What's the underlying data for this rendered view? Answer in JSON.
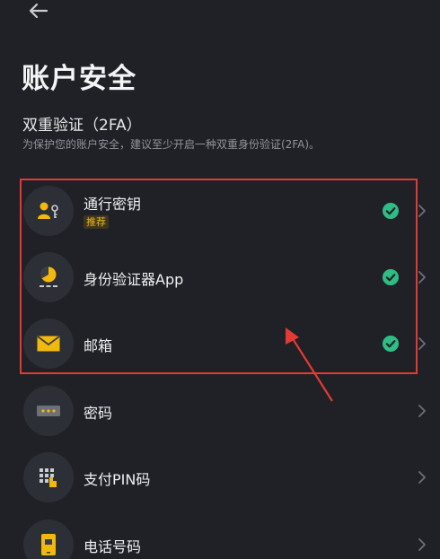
{
  "header": {
    "back_icon": "arrow-left-icon",
    "title": "账户安全"
  },
  "section_2fa": {
    "title": "双重验证（2FA）",
    "description": "为保护您的账户安全，建议至少开启一种双重身份验证(2FA)。"
  },
  "items": [
    {
      "label": "通行密钥",
      "badge": "推荐",
      "icon": "passkey-icon",
      "verified": true
    },
    {
      "label": "身份验证器App",
      "icon": "authenticator-icon",
      "verified": true
    },
    {
      "label": "邮箱",
      "icon": "email-icon",
      "verified": true
    },
    {
      "label": "密码",
      "icon": "password-icon",
      "verified": false
    },
    {
      "label": "支付PIN码",
      "icon": "pin-keypad-icon",
      "verified": false
    },
    {
      "label": "电话号码",
      "icon": "phone-icon",
      "verified": false
    }
  ],
  "colors": {
    "background": "#1f2126",
    "icon_circle": "#2c2f36",
    "accent_yellow": "#f0b90b",
    "check_green": "#2ebd85",
    "annotation_red": "#e53935"
  }
}
